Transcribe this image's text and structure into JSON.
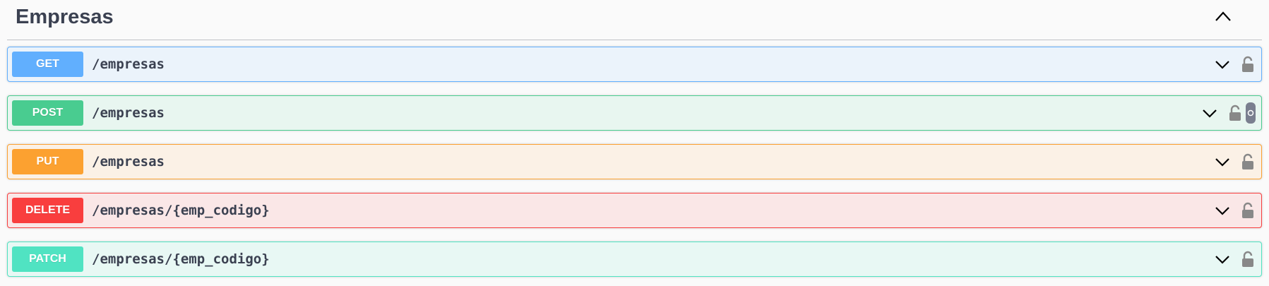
{
  "section": {
    "title": "Empresas",
    "toggle_icon": "chevron-up-icon"
  },
  "operations": [
    {
      "method": "GET",
      "path": "/empresas",
      "color": "#61affe",
      "bg": "#ebf3fb",
      "border": "#61affe"
    },
    {
      "method": "POST",
      "path": "/empresas",
      "color": "#49cc90",
      "bg": "#e8f6f0",
      "border": "#49cc90"
    },
    {
      "method": "PUT",
      "path": "/empresas",
      "color": "#fca130",
      "bg": "#fbf1e6",
      "border": "#fca130"
    },
    {
      "method": "DELETE",
      "path": "/empresas/{emp_codigo}",
      "color": "#f93e3e",
      "bg": "#fae7e7",
      "border": "#f93e3e"
    },
    {
      "method": "PATCH",
      "path": "/empresas/{emp_codigo}",
      "color": "#50e3c2",
      "bg": "#e8f8f4",
      "border": "#50e3c2"
    }
  ],
  "icons": {
    "expand": "chevron-down-icon",
    "auth": "lock-icon"
  }
}
